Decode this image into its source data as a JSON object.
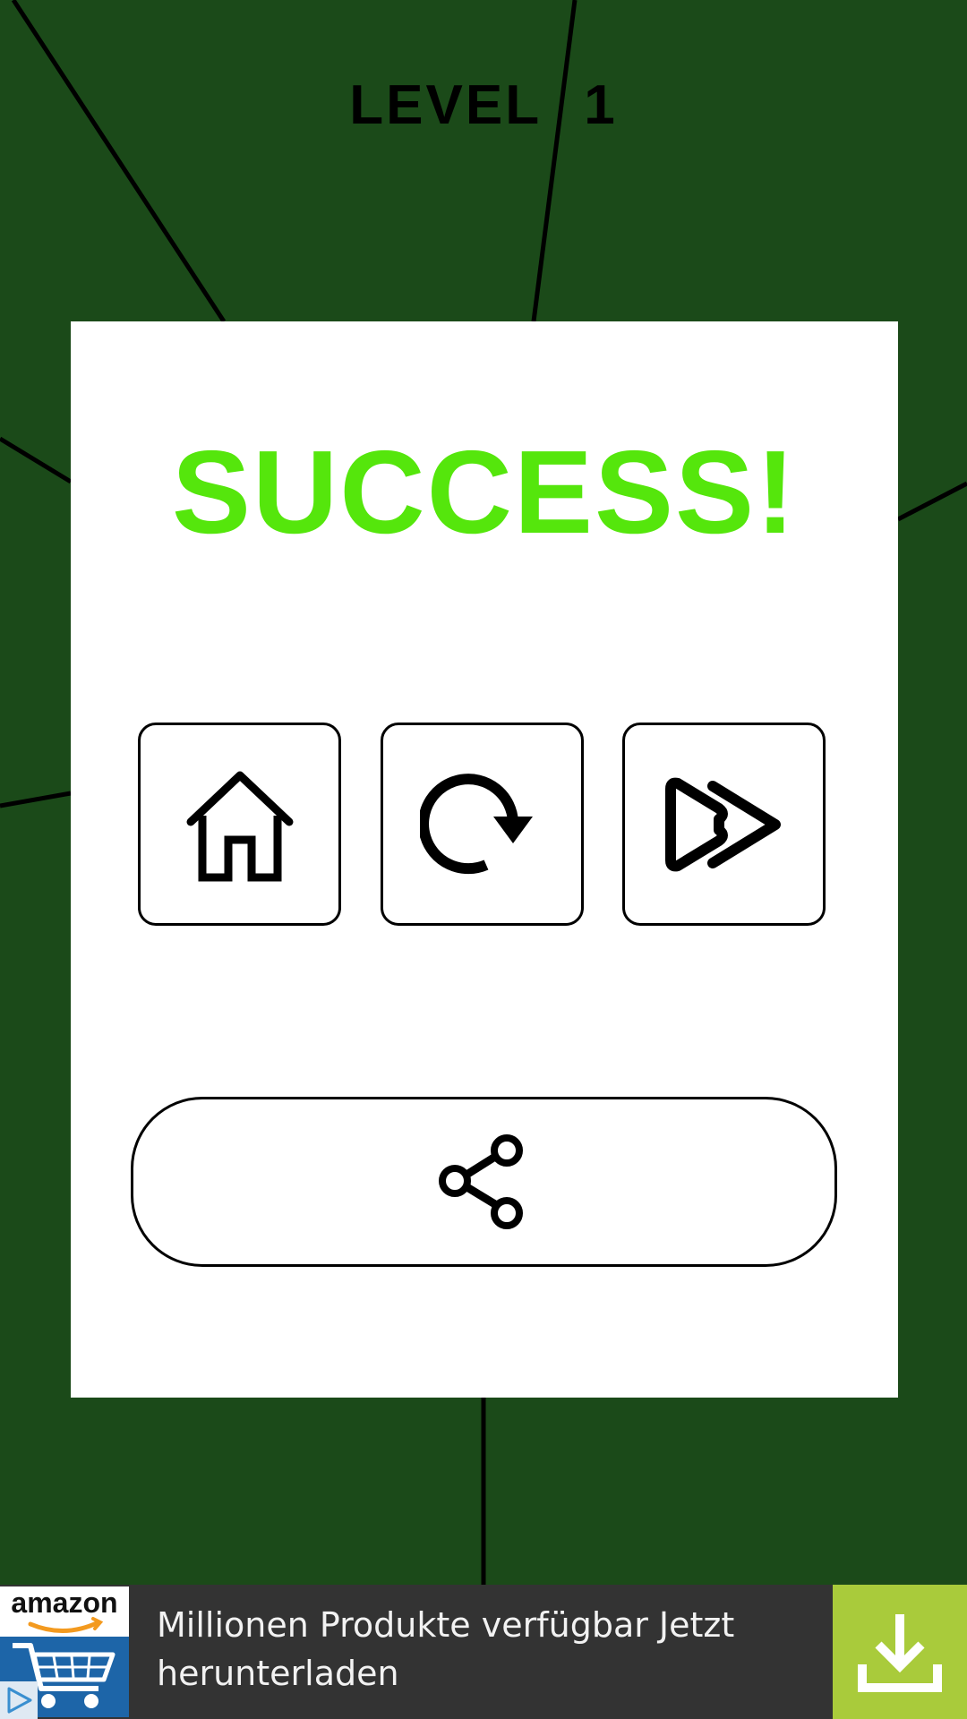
{
  "level": {
    "label": "LEVEL",
    "number": "1"
  },
  "dialog": {
    "title": "SUCCESS!",
    "title_color": "#55e60c",
    "buttons": [
      {
        "icon": "home-icon"
      },
      {
        "icon": "replay-icon"
      },
      {
        "icon": "fast-forward-icon"
      }
    ],
    "share": {
      "icon": "share-icon"
    }
  },
  "ad": {
    "brand": "amazon",
    "text": "Millionen Produkte verfügbar Jetzt herunterladen",
    "download_icon": "download-icon",
    "accent_color": "#a9cb3b"
  },
  "colors": {
    "background": "#1b4a19",
    "panel": "#ffffff"
  }
}
